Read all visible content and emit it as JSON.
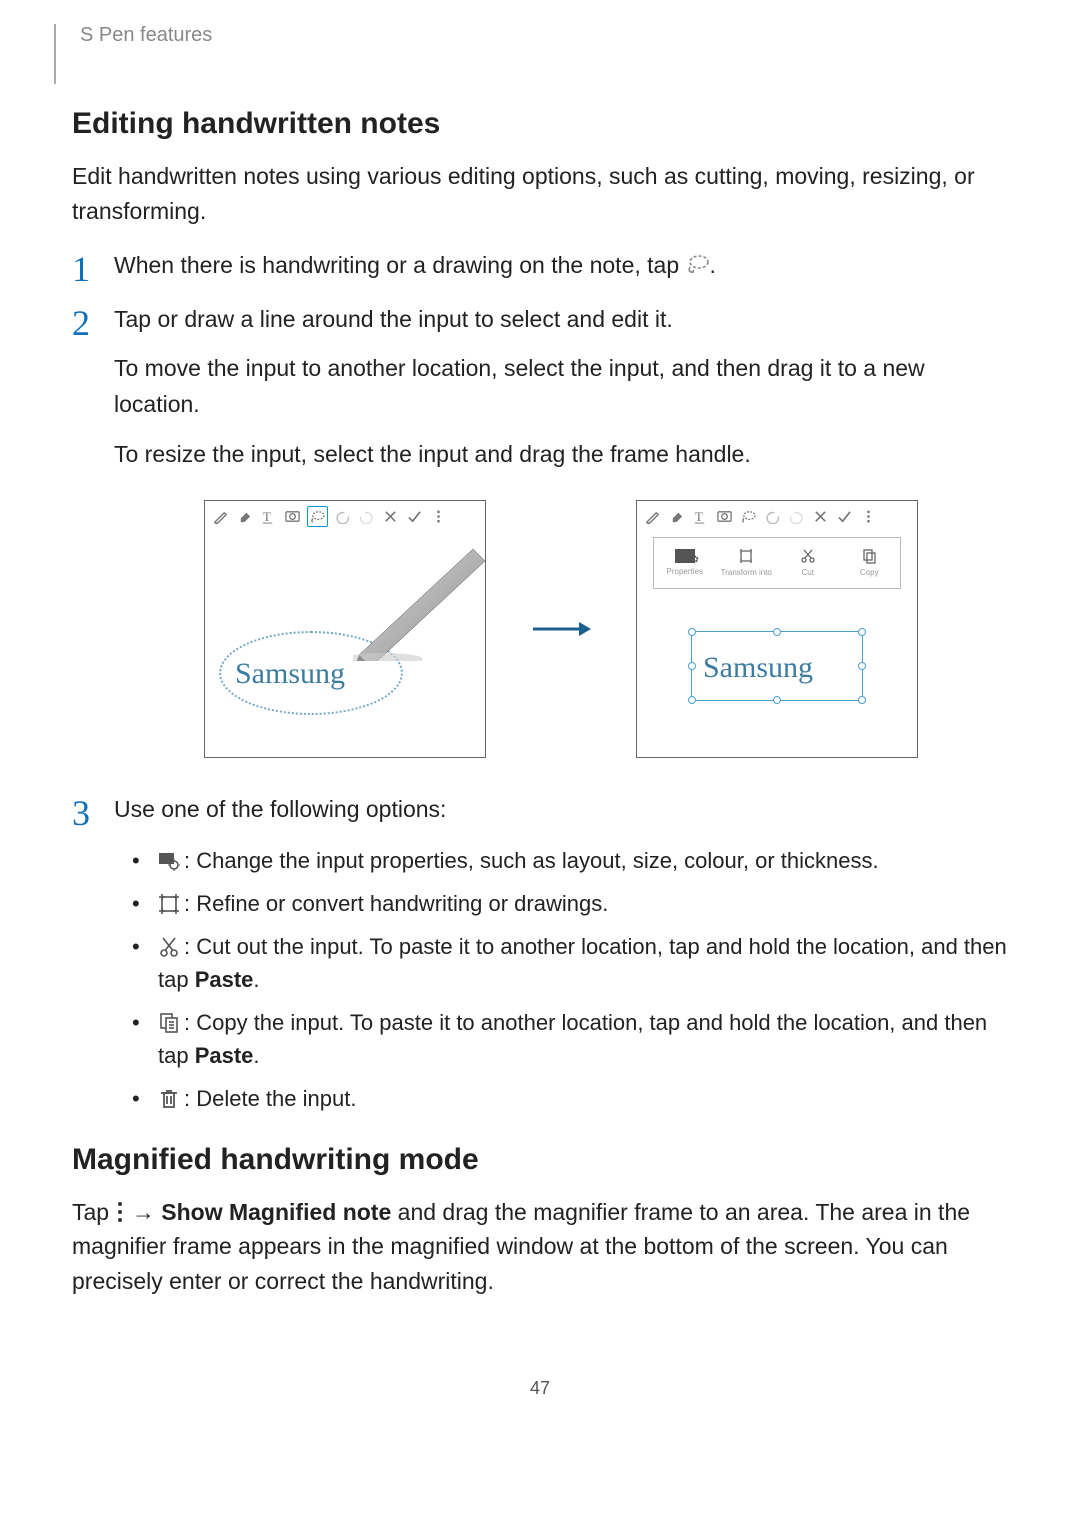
{
  "page": {
    "breadcrumb": "S Pen features",
    "number": "47"
  },
  "section1": {
    "heading": "Editing handwritten notes",
    "intro": "Edit handwritten notes using various editing options, such as cutting, moving, resizing, or transforming.",
    "steps": {
      "s1_pre": "When there is handwriting or a drawing on the note, tap ",
      "s1_post": ".",
      "s2_a": "Tap or draw a line around the input to select and edit it.",
      "s2_b": "To move the input to another location, select the input, and then drag it to a new location.",
      "s2_c": "To resize the input, select the input and drag the frame handle.",
      "s3": "Use one of the following options:"
    },
    "illustration": {
      "handwriting": "Samsung",
      "menu": {
        "properties": "Properties",
        "transform": "Transform into",
        "cut": "Cut",
        "copy": "Copy"
      }
    },
    "options": {
      "o1": ": Change the input properties, such as layout, size, colour, or thickness.",
      "o2": ": Refine or convert handwriting or drawings.",
      "o3_a": ": Cut out the input. To paste it to another location, tap and hold the location, and then tap ",
      "o3_b": "Paste",
      "o3_c": ".",
      "o4_a": ": Copy the input. To paste it to another location, tap and hold the location, and then tap ",
      "o4_b": "Paste",
      "o4_c": ".",
      "o5": ": Delete the input."
    }
  },
  "section2": {
    "heading": "Magnified handwriting mode",
    "body_a": "Tap ",
    "body_b": " → ",
    "body_c": "Show Magnified note",
    "body_d": " and drag the magnifier frame to an area. The area in the magnifier frame appears in the magnified window at the bottom of the screen. You can precisely enter or correct the handwriting."
  }
}
